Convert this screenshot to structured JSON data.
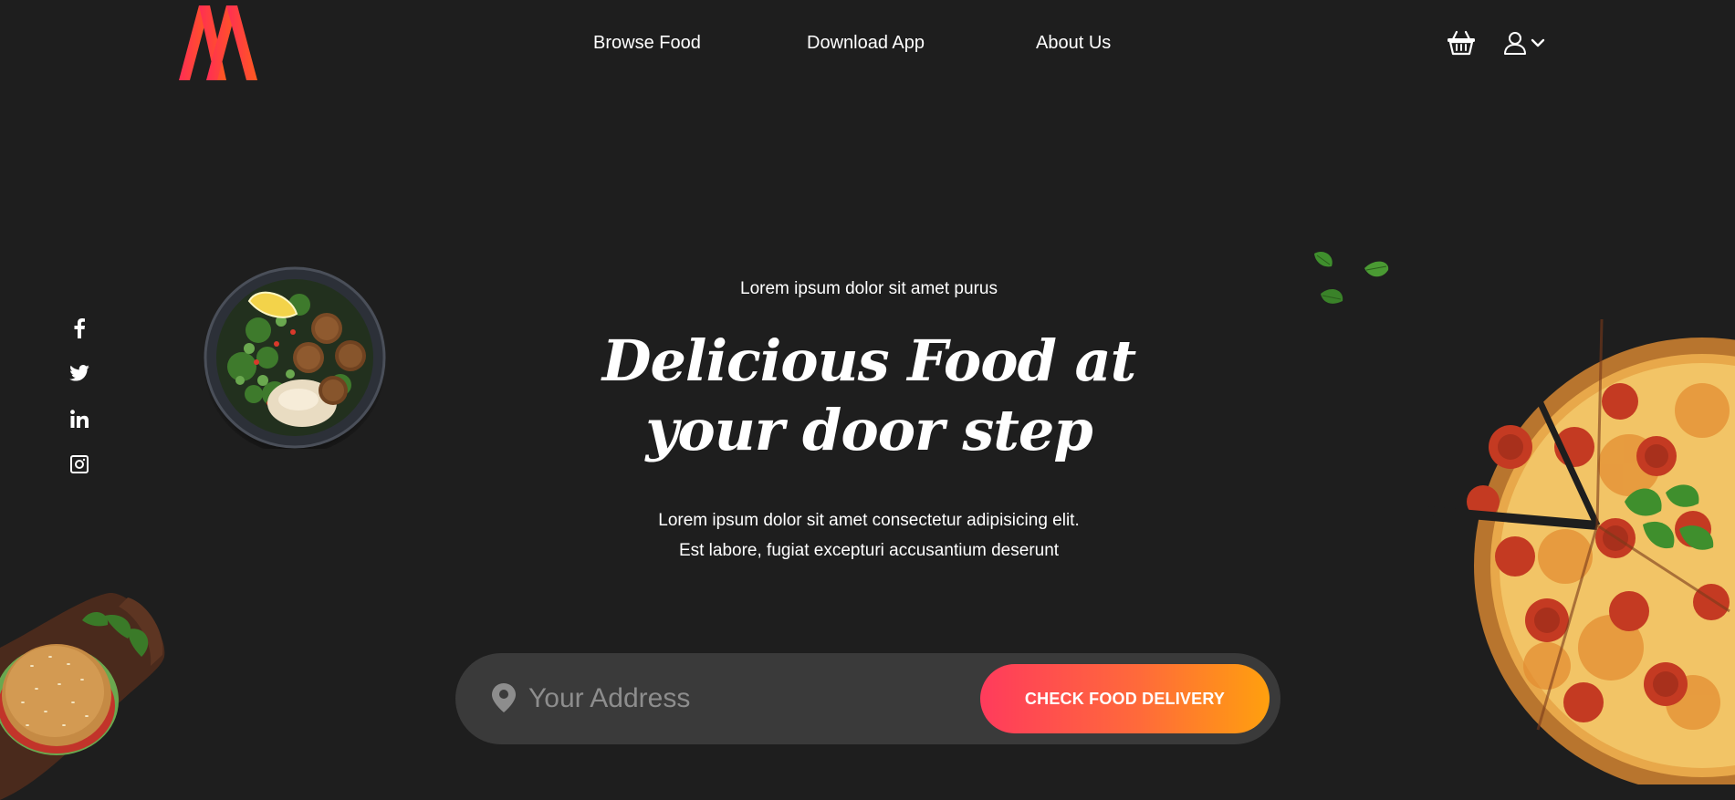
{
  "header": {
    "logo_icon": "brand-logo-icon",
    "nav": [
      {
        "label": "Browse Food"
      },
      {
        "label": "Download App"
      },
      {
        "label": "About Us"
      }
    ],
    "cart_icon": "basket-icon",
    "user_icon": "user-icon",
    "dropdown_icon": "chevron-down-icon"
  },
  "social": [
    {
      "icon": "facebook-icon"
    },
    {
      "icon": "twitter-icon"
    },
    {
      "icon": "linkedin-icon"
    },
    {
      "icon": "instagram-icon"
    }
  ],
  "hero": {
    "kicker": "Lorem ipsum dolor sit amet purus",
    "headline_line1": "Delicious Food at",
    "headline_line2": "your door step",
    "description_line1": "Lorem ipsum dolor sit amet consectetur adipisicing elit.",
    "description_line2": "Est labore, fugiat excepturi accusantium deserunt"
  },
  "search": {
    "pin_icon": "location-pin-icon",
    "placeholder": "Your Address",
    "value": "",
    "button_label": "CHECK FOOD DELIVERY"
  },
  "colors": {
    "background": "#1e1e1e",
    "input_bg": "#3a3a3a",
    "accent_start": "#ff3b5c",
    "accent_end": "#ffa00e",
    "text": "#ffffff"
  }
}
